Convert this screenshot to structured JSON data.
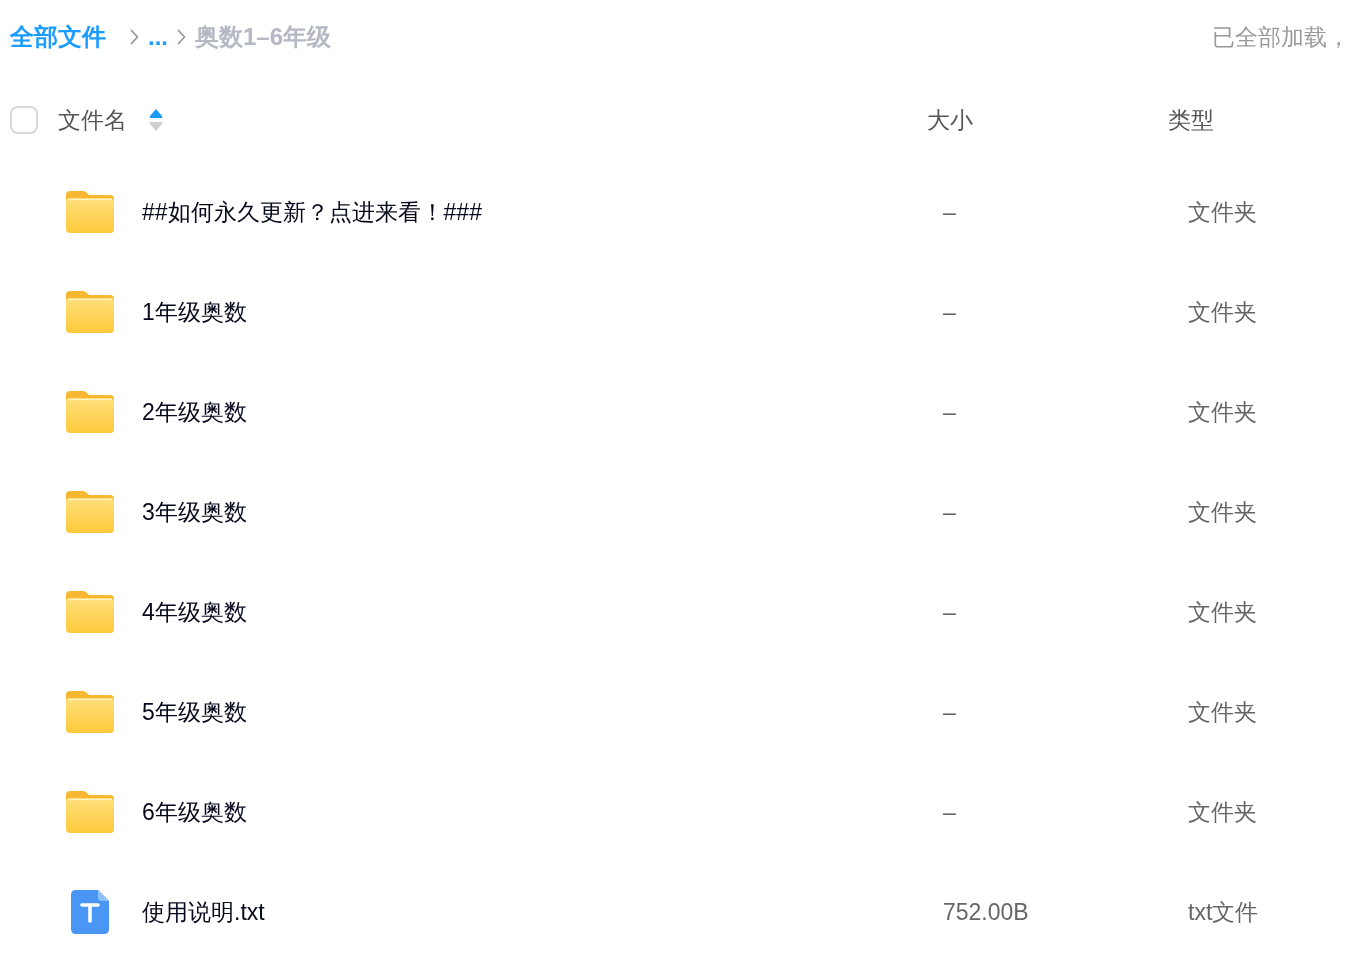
{
  "breadcrumb": {
    "items": [
      {
        "label": "全部文件",
        "kind": "link"
      },
      {
        "label": "...",
        "kind": "link"
      },
      {
        "label": "奥数1–6年级",
        "kind": "current"
      }
    ]
  },
  "status": "已全部加载，",
  "table": {
    "select_all": {
      "checked": false
    },
    "columns": [
      {
        "label": "文件名",
        "sort_ascending": true
      },
      {
        "label": "大小"
      },
      {
        "label": "类型"
      }
    ],
    "rows": [
      {
        "kind": "folder",
        "name": "##如何永久更新？点进来看！###",
        "size": "–",
        "type": "文件夹"
      },
      {
        "kind": "folder",
        "name": "1年级奥数",
        "size": "–",
        "type": "文件夹"
      },
      {
        "kind": "folder",
        "name": "2年级奥数",
        "size": "–",
        "type": "文件夹"
      },
      {
        "kind": "folder",
        "name": "3年级奥数",
        "size": "–",
        "type": "文件夹"
      },
      {
        "kind": "folder",
        "name": "4年级奥数",
        "size": "–",
        "type": "文件夹"
      },
      {
        "kind": "folder",
        "name": "5年级奥数",
        "size": "–",
        "type": "文件夹"
      },
      {
        "kind": "folder",
        "name": "6年级奥数",
        "size": "–",
        "type": "文件夹"
      },
      {
        "kind": "txt",
        "name": "使用说明.txt",
        "size": "752.00B",
        "type": "txt文件"
      }
    ]
  }
}
